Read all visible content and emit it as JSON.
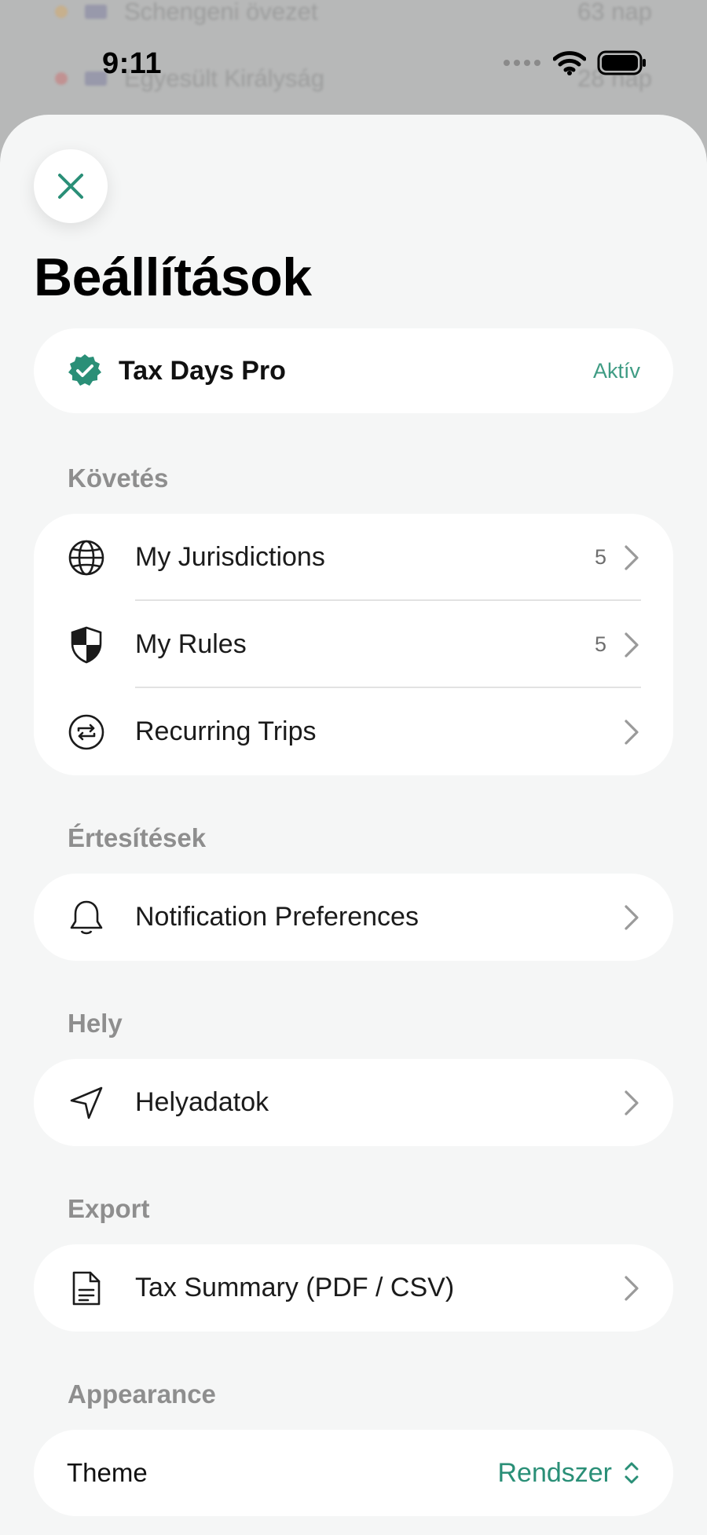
{
  "background_rows": [
    {
      "name": "Schengeni övezet",
      "value": "63 nap"
    },
    {
      "name": "Egyesült Királyság",
      "value": "28 nap"
    }
  ],
  "status_bar": {
    "time": "9:11"
  },
  "header": {
    "title": "Beállítások"
  },
  "subscription": {
    "name": "Tax Days Pro",
    "status": "Aktív"
  },
  "sections": {
    "tracking": {
      "label": "Követés",
      "items": [
        {
          "label": "My Jurisdictions",
          "count": "5"
        },
        {
          "label": "My Rules",
          "count": "5"
        },
        {
          "label": "Recurring Trips"
        }
      ]
    },
    "notifications": {
      "label": "Értesítések",
      "items": [
        {
          "label": "Notification Preferences"
        }
      ]
    },
    "location": {
      "label": "Hely",
      "items": [
        {
          "label": "Helyadatok"
        }
      ]
    },
    "export": {
      "label": "Export",
      "items": [
        {
          "label": "Tax Summary (PDF / CSV)"
        }
      ]
    },
    "appearance": {
      "label": "Appearance",
      "theme_label": "Theme",
      "theme_value": "Rendszer"
    }
  },
  "colors": {
    "accent": "#2a8f77",
    "sheet_background": "#f5f6f6",
    "card_background": "#ffffff"
  }
}
